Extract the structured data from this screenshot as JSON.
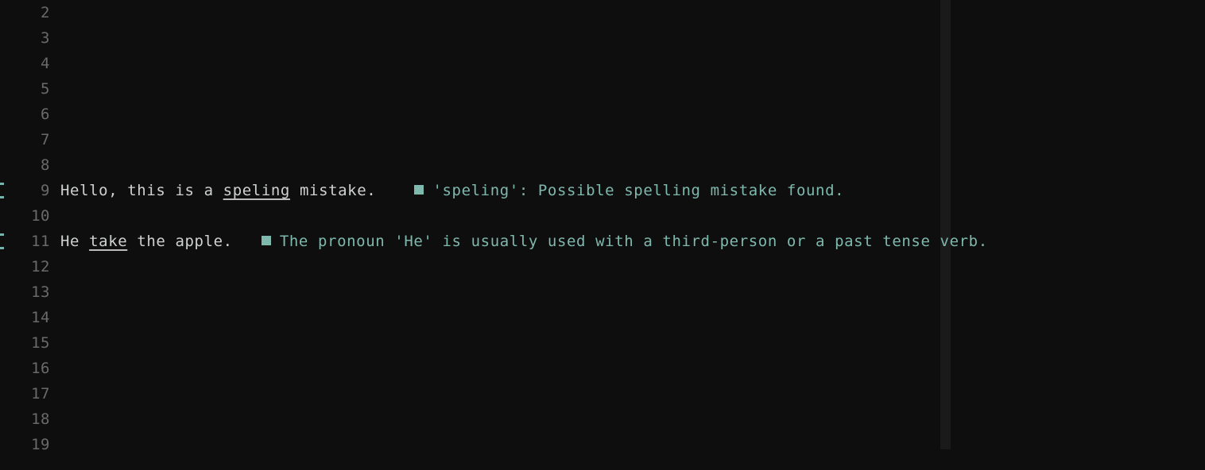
{
  "editor": {
    "background_color": "#0e0e0e",
    "line_number_color": "#6a6a6a",
    "code_text_color": "#cfd2d1",
    "diagnostic_color": "#7fb8ad",
    "minimap_color": "#1a1a1a"
  },
  "lines": [
    {
      "number": "2",
      "code": "",
      "has_marker": false,
      "diagnostic": ""
    },
    {
      "number": "3",
      "code": "",
      "has_marker": false,
      "diagnostic": ""
    },
    {
      "number": "4",
      "code": "",
      "has_marker": false,
      "diagnostic": ""
    },
    {
      "number": "5",
      "code": "",
      "has_marker": false,
      "diagnostic": ""
    },
    {
      "number": "6",
      "code": "",
      "has_marker": false,
      "diagnostic": ""
    },
    {
      "number": "7",
      "code": "",
      "has_marker": false,
      "diagnostic": ""
    },
    {
      "number": "8",
      "code": "",
      "has_marker": false,
      "diagnostic": ""
    },
    {
      "number": "9",
      "code_before": "Hello, this is a ",
      "code_error": "speling",
      "code_after": " mistake.",
      "has_marker": true,
      "diagnostic": "'speling': Possible spelling mistake found."
    },
    {
      "number": "10",
      "code": "",
      "has_marker": false,
      "diagnostic": ""
    },
    {
      "number": "11",
      "code_before": "He ",
      "code_error": "take",
      "code_after": " the apple.",
      "has_marker": true,
      "diagnostic": "The pronoun 'He' is usually used with a third-person or a past tense verb."
    },
    {
      "number": "12",
      "code": "",
      "has_marker": false,
      "diagnostic": ""
    },
    {
      "number": "13",
      "code": "",
      "has_marker": false,
      "diagnostic": ""
    },
    {
      "number": "14",
      "code": "",
      "has_marker": false,
      "diagnostic": ""
    },
    {
      "number": "15",
      "code": "",
      "has_marker": false,
      "diagnostic": ""
    },
    {
      "number": "16",
      "code": "",
      "has_marker": false,
      "diagnostic": ""
    },
    {
      "number": "17",
      "code": "",
      "has_marker": false,
      "diagnostic": ""
    },
    {
      "number": "18",
      "code": "",
      "has_marker": false,
      "diagnostic": ""
    },
    {
      "number": "19",
      "code": "",
      "has_marker": false,
      "diagnostic": ""
    }
  ]
}
